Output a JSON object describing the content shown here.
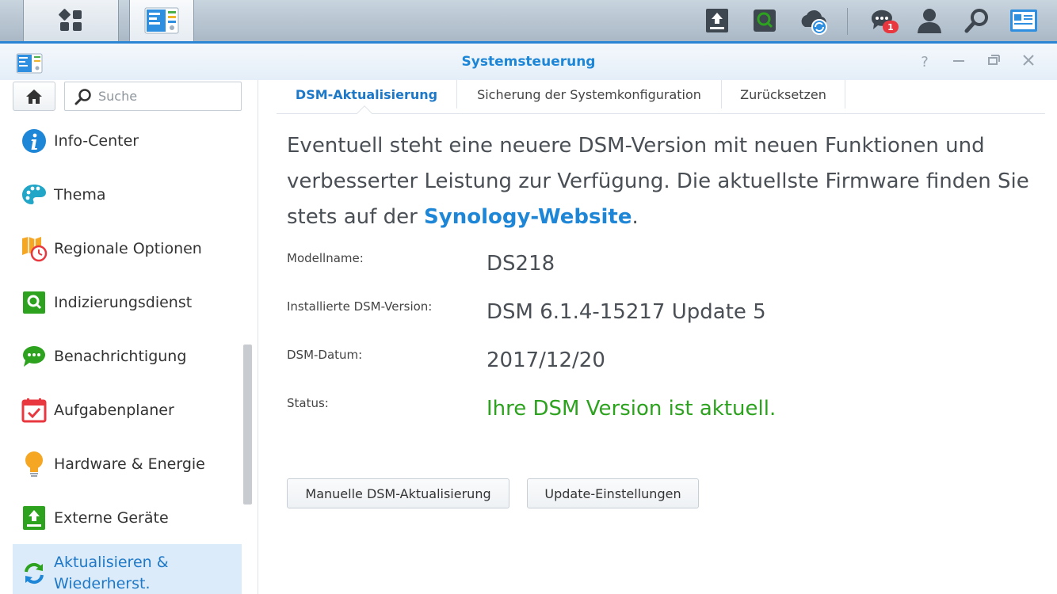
{
  "window": {
    "title": "Systemsteuerung"
  },
  "search": {
    "placeholder": "Suche"
  },
  "sidebar": {
    "items": [
      {
        "label": "Info-Center"
      },
      {
        "label": "Thema"
      },
      {
        "label": "Regionale Optionen"
      },
      {
        "label": "Indizierungsdienst"
      },
      {
        "label": "Benachrichtigung"
      },
      {
        "label": "Aufgabenplaner"
      },
      {
        "label": "Hardware & Energie"
      },
      {
        "label": "Externe Geräte"
      },
      {
        "label_line1": "Aktualisieren &",
        "label_line2": "Wiederherst."
      }
    ]
  },
  "tabs": [
    {
      "label": "DSM-Aktualisierung"
    },
    {
      "label": "Sicherung der Systemkonfiguration"
    },
    {
      "label": "Zurücksetzen"
    }
  ],
  "intro": {
    "text_before": "Eventuell steht eine neuere DSM-Version mit neuen Funktionen und verbesserter Leistung zur Verfügung. Die aktuellste Firmware finden Sie stets auf der ",
    "link": "Synology-Website",
    "text_after": "."
  },
  "info": {
    "model_label": "Modellname:",
    "model_value": "DS218",
    "version_label": "Installierte DSM-Version:",
    "version_value": "DSM 6.1.4-15217 Update 5",
    "date_label": "DSM-Datum:",
    "date_value": "2017/12/20",
    "status_label": "Status:",
    "status_value": "Ihre DSM Version ist aktuell."
  },
  "buttons": {
    "manual_update": "Manuelle DSM-Aktualisierung",
    "update_settings": "Update-Einstellungen"
  },
  "taskbar": {
    "notification_count": "1"
  },
  "colors": {
    "accent": "#1e86d6",
    "status_ok": "#2ca21e",
    "active_bg": "#dcebf9",
    "badge": "#e8373f"
  }
}
